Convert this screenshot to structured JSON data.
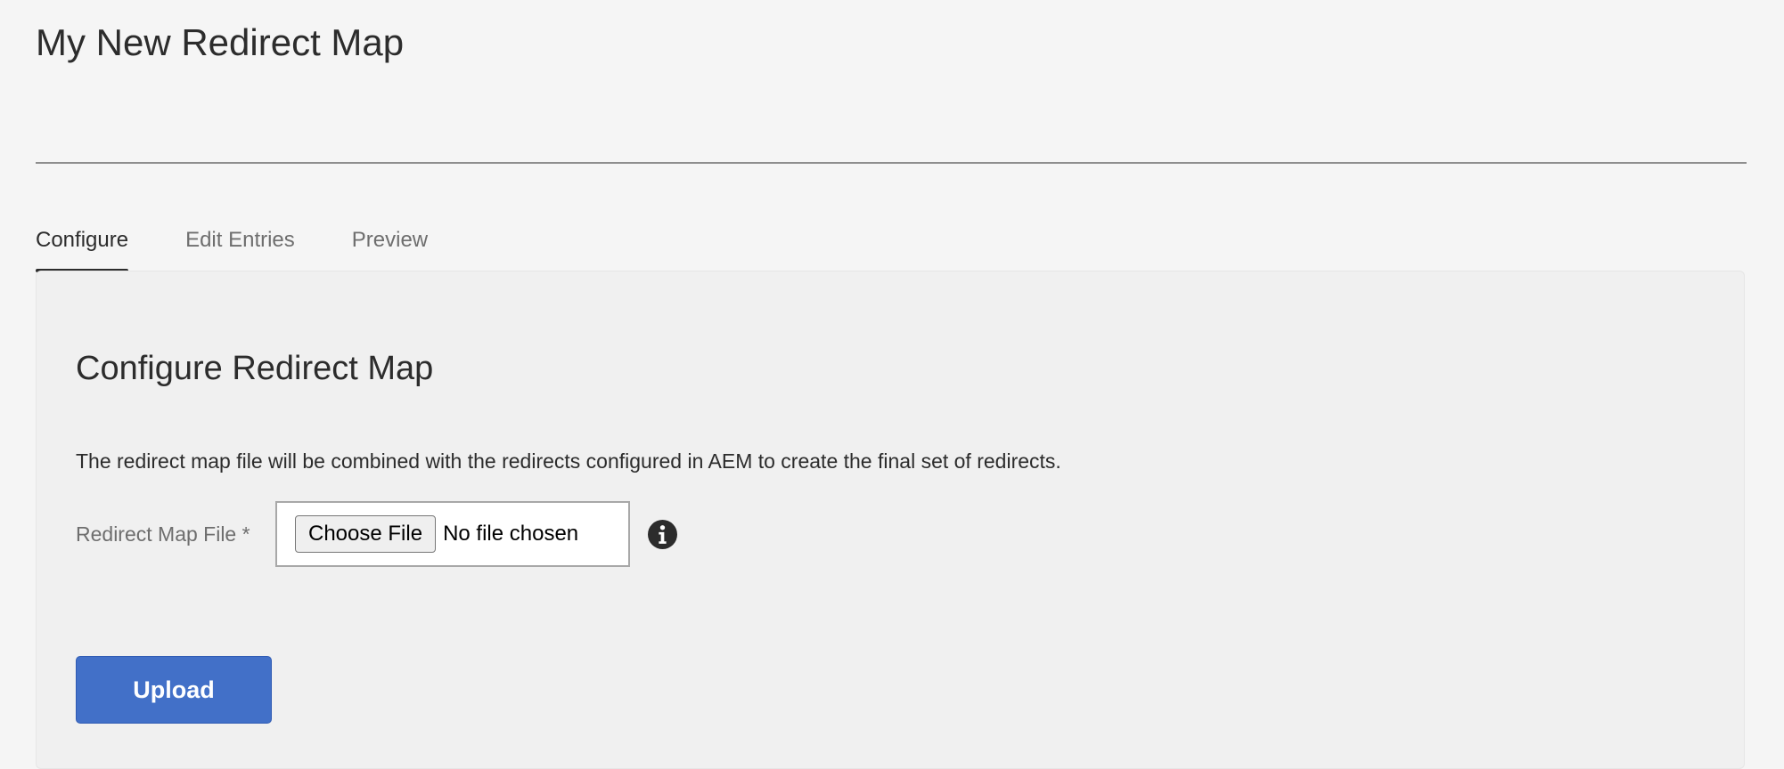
{
  "page": {
    "title": "My New Redirect Map"
  },
  "tabs": [
    {
      "label": "Configure",
      "active": true
    },
    {
      "label": "Edit Entries",
      "active": false
    },
    {
      "label": "Preview",
      "active": false
    }
  ],
  "configure": {
    "heading": "Configure Redirect Map",
    "description": "The redirect map file will be combined with the redirects configured in AEM to create the final set of redirects.",
    "file_field": {
      "label": "Redirect Map File *",
      "button_label": "Choose File",
      "status": "No file chosen",
      "info_icon": "info-circle-icon"
    },
    "upload_label": "Upload"
  },
  "colors": {
    "primary_button": "#4270c8",
    "page_background": "#f5f5f5",
    "panel_background": "#f0f0f0",
    "active_tab_indicator": "#2c2c2c"
  }
}
